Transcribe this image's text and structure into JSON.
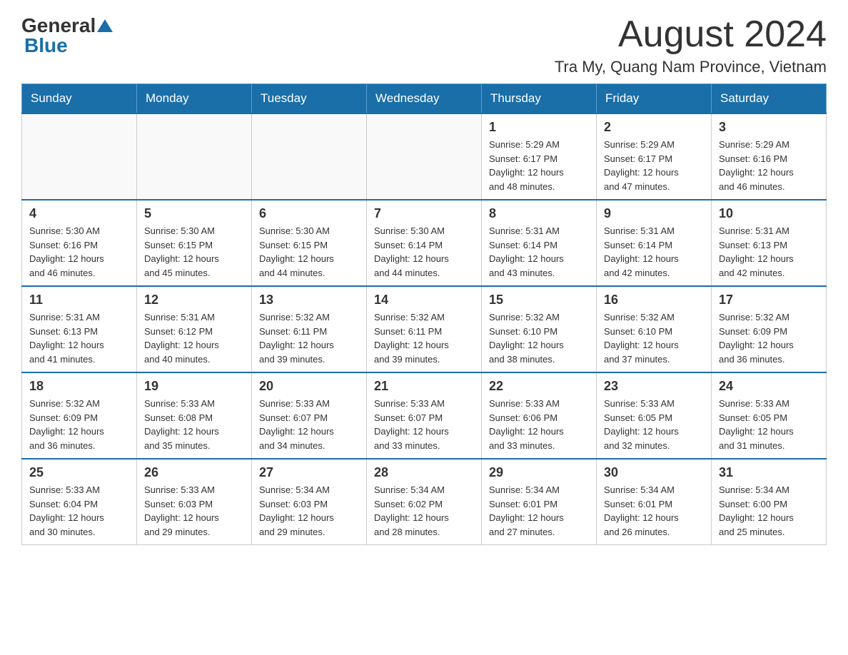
{
  "header": {
    "logo_general": "General",
    "logo_blue": "Blue",
    "month_title": "August 2024",
    "location": "Tra My, Quang Nam Province, Vietnam"
  },
  "days_of_week": [
    "Sunday",
    "Monday",
    "Tuesday",
    "Wednesday",
    "Thursday",
    "Friday",
    "Saturday"
  ],
  "weeks": [
    [
      {
        "day": "",
        "info": ""
      },
      {
        "day": "",
        "info": ""
      },
      {
        "day": "",
        "info": ""
      },
      {
        "day": "",
        "info": ""
      },
      {
        "day": "1",
        "info": "Sunrise: 5:29 AM\nSunset: 6:17 PM\nDaylight: 12 hours\nand 48 minutes."
      },
      {
        "day": "2",
        "info": "Sunrise: 5:29 AM\nSunset: 6:17 PM\nDaylight: 12 hours\nand 47 minutes."
      },
      {
        "day": "3",
        "info": "Sunrise: 5:29 AM\nSunset: 6:16 PM\nDaylight: 12 hours\nand 46 minutes."
      }
    ],
    [
      {
        "day": "4",
        "info": "Sunrise: 5:30 AM\nSunset: 6:16 PM\nDaylight: 12 hours\nand 46 minutes."
      },
      {
        "day": "5",
        "info": "Sunrise: 5:30 AM\nSunset: 6:15 PM\nDaylight: 12 hours\nand 45 minutes."
      },
      {
        "day": "6",
        "info": "Sunrise: 5:30 AM\nSunset: 6:15 PM\nDaylight: 12 hours\nand 44 minutes."
      },
      {
        "day": "7",
        "info": "Sunrise: 5:30 AM\nSunset: 6:14 PM\nDaylight: 12 hours\nand 44 minutes."
      },
      {
        "day": "8",
        "info": "Sunrise: 5:31 AM\nSunset: 6:14 PM\nDaylight: 12 hours\nand 43 minutes."
      },
      {
        "day": "9",
        "info": "Sunrise: 5:31 AM\nSunset: 6:14 PM\nDaylight: 12 hours\nand 42 minutes."
      },
      {
        "day": "10",
        "info": "Sunrise: 5:31 AM\nSunset: 6:13 PM\nDaylight: 12 hours\nand 42 minutes."
      }
    ],
    [
      {
        "day": "11",
        "info": "Sunrise: 5:31 AM\nSunset: 6:13 PM\nDaylight: 12 hours\nand 41 minutes."
      },
      {
        "day": "12",
        "info": "Sunrise: 5:31 AM\nSunset: 6:12 PM\nDaylight: 12 hours\nand 40 minutes."
      },
      {
        "day": "13",
        "info": "Sunrise: 5:32 AM\nSunset: 6:11 PM\nDaylight: 12 hours\nand 39 minutes."
      },
      {
        "day": "14",
        "info": "Sunrise: 5:32 AM\nSunset: 6:11 PM\nDaylight: 12 hours\nand 39 minutes."
      },
      {
        "day": "15",
        "info": "Sunrise: 5:32 AM\nSunset: 6:10 PM\nDaylight: 12 hours\nand 38 minutes."
      },
      {
        "day": "16",
        "info": "Sunrise: 5:32 AM\nSunset: 6:10 PM\nDaylight: 12 hours\nand 37 minutes."
      },
      {
        "day": "17",
        "info": "Sunrise: 5:32 AM\nSunset: 6:09 PM\nDaylight: 12 hours\nand 36 minutes."
      }
    ],
    [
      {
        "day": "18",
        "info": "Sunrise: 5:32 AM\nSunset: 6:09 PM\nDaylight: 12 hours\nand 36 minutes."
      },
      {
        "day": "19",
        "info": "Sunrise: 5:33 AM\nSunset: 6:08 PM\nDaylight: 12 hours\nand 35 minutes."
      },
      {
        "day": "20",
        "info": "Sunrise: 5:33 AM\nSunset: 6:07 PM\nDaylight: 12 hours\nand 34 minutes."
      },
      {
        "day": "21",
        "info": "Sunrise: 5:33 AM\nSunset: 6:07 PM\nDaylight: 12 hours\nand 33 minutes."
      },
      {
        "day": "22",
        "info": "Sunrise: 5:33 AM\nSunset: 6:06 PM\nDaylight: 12 hours\nand 33 minutes."
      },
      {
        "day": "23",
        "info": "Sunrise: 5:33 AM\nSunset: 6:05 PM\nDaylight: 12 hours\nand 32 minutes."
      },
      {
        "day": "24",
        "info": "Sunrise: 5:33 AM\nSunset: 6:05 PM\nDaylight: 12 hours\nand 31 minutes."
      }
    ],
    [
      {
        "day": "25",
        "info": "Sunrise: 5:33 AM\nSunset: 6:04 PM\nDaylight: 12 hours\nand 30 minutes."
      },
      {
        "day": "26",
        "info": "Sunrise: 5:33 AM\nSunset: 6:03 PM\nDaylight: 12 hours\nand 29 minutes."
      },
      {
        "day": "27",
        "info": "Sunrise: 5:34 AM\nSunset: 6:03 PM\nDaylight: 12 hours\nand 29 minutes."
      },
      {
        "day": "28",
        "info": "Sunrise: 5:34 AM\nSunset: 6:02 PM\nDaylight: 12 hours\nand 28 minutes."
      },
      {
        "day": "29",
        "info": "Sunrise: 5:34 AM\nSunset: 6:01 PM\nDaylight: 12 hours\nand 27 minutes."
      },
      {
        "day": "30",
        "info": "Sunrise: 5:34 AM\nSunset: 6:01 PM\nDaylight: 12 hours\nand 26 minutes."
      },
      {
        "day": "31",
        "info": "Sunrise: 5:34 AM\nSunset: 6:00 PM\nDaylight: 12 hours\nand 25 minutes."
      }
    ]
  ]
}
